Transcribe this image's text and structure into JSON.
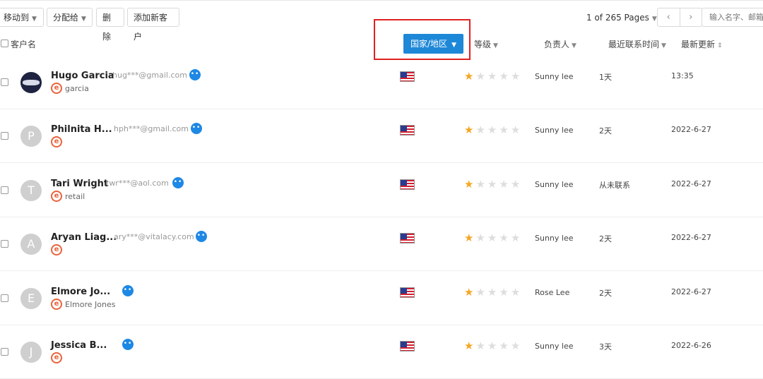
{
  "toolbar": {
    "move_to": "移动到",
    "assign_to": "分配给",
    "delete": "删除",
    "add_customer": "添加新客户",
    "pages": "1 of 265 Pages",
    "search_placeholder": "输入名字、邮箱"
  },
  "header": {
    "customer_name": "客户名",
    "country": "国家/地区",
    "level": "等级",
    "owner": "负责人",
    "last_contact": "最近联系时间",
    "last_updated": "最新更新"
  },
  "rows": [
    {
      "initial": "",
      "name": "Hugo Garcia",
      "email": "hug***@gmail.com",
      "tag": "garcia",
      "rating": 1,
      "owner": "Sunny lee",
      "last_contact": "1天",
      "updated": "13:35"
    },
    {
      "initial": "P",
      "name": "Philnita H...",
      "email": "hph***@gmail.com",
      "tag": "",
      "rating": 1,
      "owner": "Sunny lee",
      "last_contact": "2天",
      "updated": "2022-6-27"
    },
    {
      "initial": "T",
      "name": "Tari Wright",
      "email": "twr***@aol.com",
      "tag": "retail",
      "rating": 1,
      "owner": "Sunny lee",
      "last_contact": "从未联系",
      "updated": "2022-6-27"
    },
    {
      "initial": "A",
      "name": "Aryan Liag...",
      "email": "ary***@vitalacy.com",
      "tag": "",
      "rating": 1,
      "owner": "Sunny lee",
      "last_contact": "2天",
      "updated": "2022-6-27"
    },
    {
      "initial": "E",
      "name": "Elmore Jo...",
      "email": "",
      "tag": "Elmore Jones",
      "rating": 1,
      "owner": "Rose Lee",
      "last_contact": "2天",
      "updated": "2022-6-27"
    },
    {
      "initial": "J",
      "name": "Jessica B...",
      "email": "",
      "tag": "",
      "rating": 1,
      "owner": "Sunny lee",
      "last_contact": "3天",
      "updated": "2022-6-26"
    }
  ],
  "colors": {
    "accent": "#1e88d8",
    "highlight": "#e02020",
    "star": "#f5a623"
  }
}
